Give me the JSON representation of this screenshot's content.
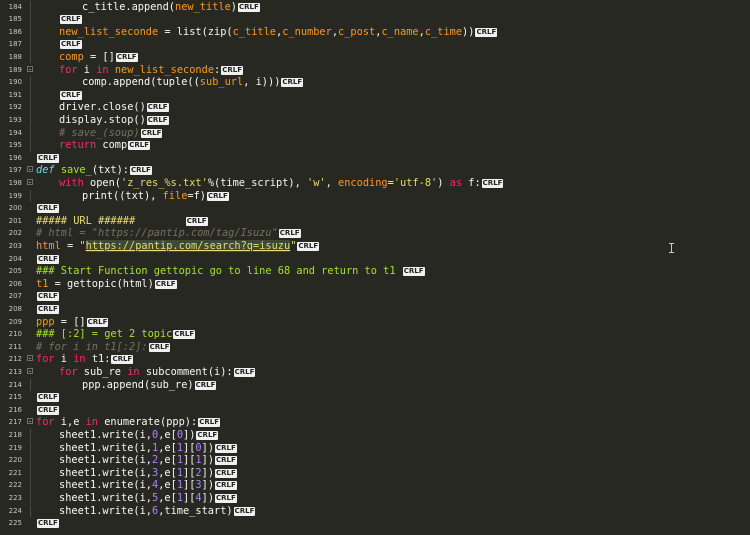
{
  "editor": {
    "newline_marker": "CRLF",
    "lines": [
      {
        "n": "184",
        "fold": false,
        "guide": true,
        "indent": 2,
        "crlf": true,
        "segs": [
          [
            "pl",
            "c_title.append("
          ],
          [
            "or",
            "new_title"
          ],
          [
            "pl",
            ")"
          ]
        ]
      },
      {
        "n": "185",
        "fold": false,
        "guide": true,
        "indent": 1,
        "crlf": true,
        "segs": []
      },
      {
        "n": "186",
        "fold": false,
        "guide": true,
        "indent": 1,
        "crlf": true,
        "segs": [
          [
            "or",
            "new_list_seconde"
          ],
          [
            "pl",
            " = list(zip("
          ],
          [
            "or",
            "c_title"
          ],
          [
            "pl",
            ","
          ],
          [
            "or",
            "c_number"
          ],
          [
            "pl",
            ","
          ],
          [
            "or",
            "c_post"
          ],
          [
            "pl",
            ","
          ],
          [
            "or",
            "c_name"
          ],
          [
            "pl",
            ","
          ],
          [
            "or",
            "c_time"
          ],
          [
            "pl",
            "))"
          ]
        ]
      },
      {
        "n": "187",
        "fold": false,
        "guide": true,
        "indent": 1,
        "crlf": true,
        "segs": []
      },
      {
        "n": "188",
        "fold": false,
        "guide": true,
        "indent": 1,
        "crlf": true,
        "segs": [
          [
            "or",
            "comp"
          ],
          [
            "pl",
            " = []"
          ]
        ]
      },
      {
        "n": "189",
        "fold": true,
        "guide": false,
        "indent": 1,
        "crlf": true,
        "segs": [
          [
            "kw",
            "for"
          ],
          [
            "pl",
            " i "
          ],
          [
            "kw",
            "in"
          ],
          [
            "pl",
            " "
          ],
          [
            "or",
            "new_list_seconde"
          ],
          [
            "pl",
            ":"
          ]
        ]
      },
      {
        "n": "190",
        "fold": false,
        "guide": true,
        "indent": 2,
        "crlf": true,
        "segs": [
          [
            "pl",
            "comp.append(tuple(("
          ],
          [
            "or",
            "sub_url"
          ],
          [
            "pl",
            ", i)))"
          ]
        ]
      },
      {
        "n": "191",
        "fold": false,
        "guide": true,
        "indent": 1,
        "crlf": true,
        "segs": []
      },
      {
        "n": "192",
        "fold": false,
        "guide": true,
        "indent": 1,
        "crlf": true,
        "segs": [
          [
            "pl",
            "driver.close()"
          ]
        ]
      },
      {
        "n": "193",
        "fold": false,
        "guide": true,
        "indent": 1,
        "crlf": true,
        "segs": [
          [
            "pl",
            "display.stop()"
          ]
        ]
      },
      {
        "n": "194",
        "fold": false,
        "guide": true,
        "indent": 1,
        "crlf": true,
        "segs": [
          [
            "cmt",
            "# save_(soup)"
          ]
        ]
      },
      {
        "n": "195",
        "fold": false,
        "guide": true,
        "indent": 1,
        "crlf": true,
        "segs": [
          [
            "kw",
            "return"
          ],
          [
            "pl",
            " comp"
          ]
        ]
      },
      {
        "n": "196",
        "fold": false,
        "guide": false,
        "indent": 0,
        "crlf": true,
        "segs": []
      },
      {
        "n": "197",
        "fold": true,
        "guide": false,
        "indent": 0,
        "crlf": true,
        "segs": [
          [
            "def",
            "def"
          ],
          [
            "pl",
            " "
          ],
          [
            "fn",
            "save_"
          ],
          [
            "pl",
            "(txt):"
          ]
        ]
      },
      {
        "n": "198",
        "fold": true,
        "guide": false,
        "indent": 1,
        "crlf": true,
        "segs": [
          [
            "kw",
            "with"
          ],
          [
            "pl",
            " open("
          ],
          [
            "str",
            "'z_res_%s.txt'"
          ],
          [
            "pl",
            "%(time_script), "
          ],
          [
            "str",
            "'w'"
          ],
          [
            "pl",
            ", "
          ],
          [
            "or",
            "encoding"
          ],
          [
            "pl",
            "="
          ],
          [
            "str",
            "'utf-8'"
          ],
          [
            "pl",
            ") "
          ],
          [
            "kw",
            "as"
          ],
          [
            "pl",
            " f:"
          ]
        ]
      },
      {
        "n": "199",
        "fold": false,
        "guide": true,
        "indent": 2,
        "crlf": true,
        "segs": [
          [
            "pl",
            "print((txt), "
          ],
          [
            "or",
            "file"
          ],
          [
            "pl",
            "=f)"
          ]
        ]
      },
      {
        "n": "200",
        "fold": false,
        "guide": false,
        "indent": 0,
        "crlf": true,
        "segs": []
      },
      {
        "n": "201",
        "fold": false,
        "guide": false,
        "indent": 0,
        "crlf": true,
        "segs": [
          [
            "str",
            "##### URL ######        "
          ]
        ]
      },
      {
        "n": "202",
        "fold": false,
        "guide": false,
        "indent": 0,
        "crlf": true,
        "segs": [
          [
            "cmt",
            "# html = \""
          ],
          [
            "cmt",
            "https://pantip.com/tag/Isuzu"
          ],
          [
            "cmt",
            "\""
          ]
        ]
      },
      {
        "n": "203",
        "fold": false,
        "guide": false,
        "indent": 0,
        "crlf": true,
        "segs": [
          [
            "or",
            "html"
          ],
          [
            "pl",
            " = "
          ],
          [
            "str",
            "\""
          ],
          [
            "urlsel",
            "https://pantip.com/search?q=isuzu"
          ],
          [
            "str",
            "\""
          ]
        ]
      },
      {
        "n": "204",
        "fold": false,
        "guide": false,
        "indent": 0,
        "crlf": true,
        "segs": []
      },
      {
        "n": "205",
        "fold": false,
        "guide": false,
        "indent": 0,
        "crlf": true,
        "segs": [
          [
            "fn",
            "### Start Function gettopic go to line 68 and return to t1 "
          ]
        ]
      },
      {
        "n": "206",
        "fold": false,
        "guide": false,
        "indent": 0,
        "crlf": true,
        "segs": [
          [
            "or",
            "t1"
          ],
          [
            "pl",
            " = gettopic(html)"
          ]
        ]
      },
      {
        "n": "207",
        "fold": false,
        "guide": false,
        "indent": 0,
        "crlf": true,
        "segs": []
      },
      {
        "n": "208",
        "fold": false,
        "guide": false,
        "indent": 0,
        "crlf": true,
        "segs": []
      },
      {
        "n": "209",
        "fold": false,
        "guide": false,
        "indent": 0,
        "crlf": true,
        "segs": [
          [
            "or",
            "ppp"
          ],
          [
            "pl",
            " = []"
          ]
        ]
      },
      {
        "n": "210",
        "fold": false,
        "guide": false,
        "indent": 0,
        "crlf": true,
        "segs": [
          [
            "fn",
            "### [:2] = get 2 topic"
          ]
        ]
      },
      {
        "n": "211",
        "fold": false,
        "guide": false,
        "indent": 0,
        "crlf": true,
        "segs": [
          [
            "cmt",
            "# for i in t1[:2]:"
          ]
        ]
      },
      {
        "n": "212",
        "fold": true,
        "guide": false,
        "indent": 0,
        "crlf": true,
        "segs": [
          [
            "kw",
            "for"
          ],
          [
            "pl",
            " i "
          ],
          [
            "kw",
            "in"
          ],
          [
            "pl",
            " t1:"
          ]
        ]
      },
      {
        "n": "213",
        "fold": true,
        "guide": false,
        "indent": 1,
        "crlf": true,
        "segs": [
          [
            "kw",
            "for"
          ],
          [
            "pl",
            " sub_re "
          ],
          [
            "kw",
            "in"
          ],
          [
            "pl",
            " subcomment(i):"
          ]
        ]
      },
      {
        "n": "214",
        "fold": false,
        "guide": true,
        "indent": 2,
        "crlf": true,
        "segs": [
          [
            "pl",
            "ppp.append(sub_re)"
          ]
        ]
      },
      {
        "n": "215",
        "fold": false,
        "guide": false,
        "indent": 0,
        "crlf": true,
        "segs": []
      },
      {
        "n": "216",
        "fold": false,
        "guide": false,
        "indent": 0,
        "crlf": true,
        "segs": []
      },
      {
        "n": "217",
        "fold": true,
        "guide": false,
        "indent": 0,
        "crlf": true,
        "segs": [
          [
            "kw",
            "for"
          ],
          [
            "pl",
            " i,e "
          ],
          [
            "kw",
            "in"
          ],
          [
            "pl",
            " enumerate(ppp):"
          ]
        ]
      },
      {
        "n": "218",
        "fold": false,
        "guide": true,
        "indent": 1,
        "crlf": true,
        "segs": [
          [
            "pl",
            "sheet1.write(i,"
          ],
          [
            "num",
            "0"
          ],
          [
            "pl",
            ",e["
          ],
          [
            "num",
            "0"
          ],
          [
            "pl",
            "])"
          ]
        ]
      },
      {
        "n": "219",
        "fold": false,
        "guide": true,
        "indent": 1,
        "crlf": true,
        "segs": [
          [
            "pl",
            "sheet1.write(i,"
          ],
          [
            "num",
            "1"
          ],
          [
            "pl",
            ",e["
          ],
          [
            "num",
            "1"
          ],
          [
            "pl",
            "]["
          ],
          [
            "num",
            "0"
          ],
          [
            "pl",
            "])"
          ]
        ]
      },
      {
        "n": "220",
        "fold": false,
        "guide": true,
        "indent": 1,
        "crlf": true,
        "segs": [
          [
            "pl",
            "sheet1.write(i,"
          ],
          [
            "num",
            "2"
          ],
          [
            "pl",
            ",e["
          ],
          [
            "num",
            "1"
          ],
          [
            "pl",
            "]["
          ],
          [
            "num",
            "1"
          ],
          [
            "pl",
            "])"
          ]
        ]
      },
      {
        "n": "221",
        "fold": false,
        "guide": true,
        "indent": 1,
        "crlf": true,
        "segs": [
          [
            "pl",
            "sheet1.write(i,"
          ],
          [
            "num",
            "3"
          ],
          [
            "pl",
            ",e["
          ],
          [
            "num",
            "1"
          ],
          [
            "pl",
            "]["
          ],
          [
            "num",
            "2"
          ],
          [
            "pl",
            "])"
          ]
        ]
      },
      {
        "n": "222",
        "fold": false,
        "guide": true,
        "indent": 1,
        "crlf": true,
        "segs": [
          [
            "pl",
            "sheet1.write(i,"
          ],
          [
            "num",
            "4"
          ],
          [
            "pl",
            ",e["
          ],
          [
            "num",
            "1"
          ],
          [
            "pl",
            "]["
          ],
          [
            "num",
            "3"
          ],
          [
            "pl",
            "])"
          ]
        ]
      },
      {
        "n": "223",
        "fold": false,
        "guide": true,
        "indent": 1,
        "crlf": true,
        "segs": [
          [
            "pl",
            "sheet1.write(i,"
          ],
          [
            "num",
            "5"
          ],
          [
            "pl",
            ",e["
          ],
          [
            "num",
            "1"
          ],
          [
            "pl",
            "]["
          ],
          [
            "num",
            "4"
          ],
          [
            "pl",
            "])"
          ]
        ]
      },
      {
        "n": "224",
        "fold": false,
        "guide": true,
        "indent": 1,
        "crlf": true,
        "segs": [
          [
            "pl",
            "sheet1.write(i,"
          ],
          [
            "num",
            "6"
          ],
          [
            "pl",
            ",time_start)"
          ]
        ]
      },
      {
        "n": "225",
        "fold": false,
        "guide": false,
        "indent": 0,
        "crlf": true,
        "segs": []
      }
    ]
  },
  "colors": {
    "background": "#272822",
    "keyword": "#f92672",
    "function": "#a6e22e",
    "string": "#e6db74",
    "number": "#ae81ff",
    "comment": "#75715e",
    "variable": "#fd971f"
  }
}
